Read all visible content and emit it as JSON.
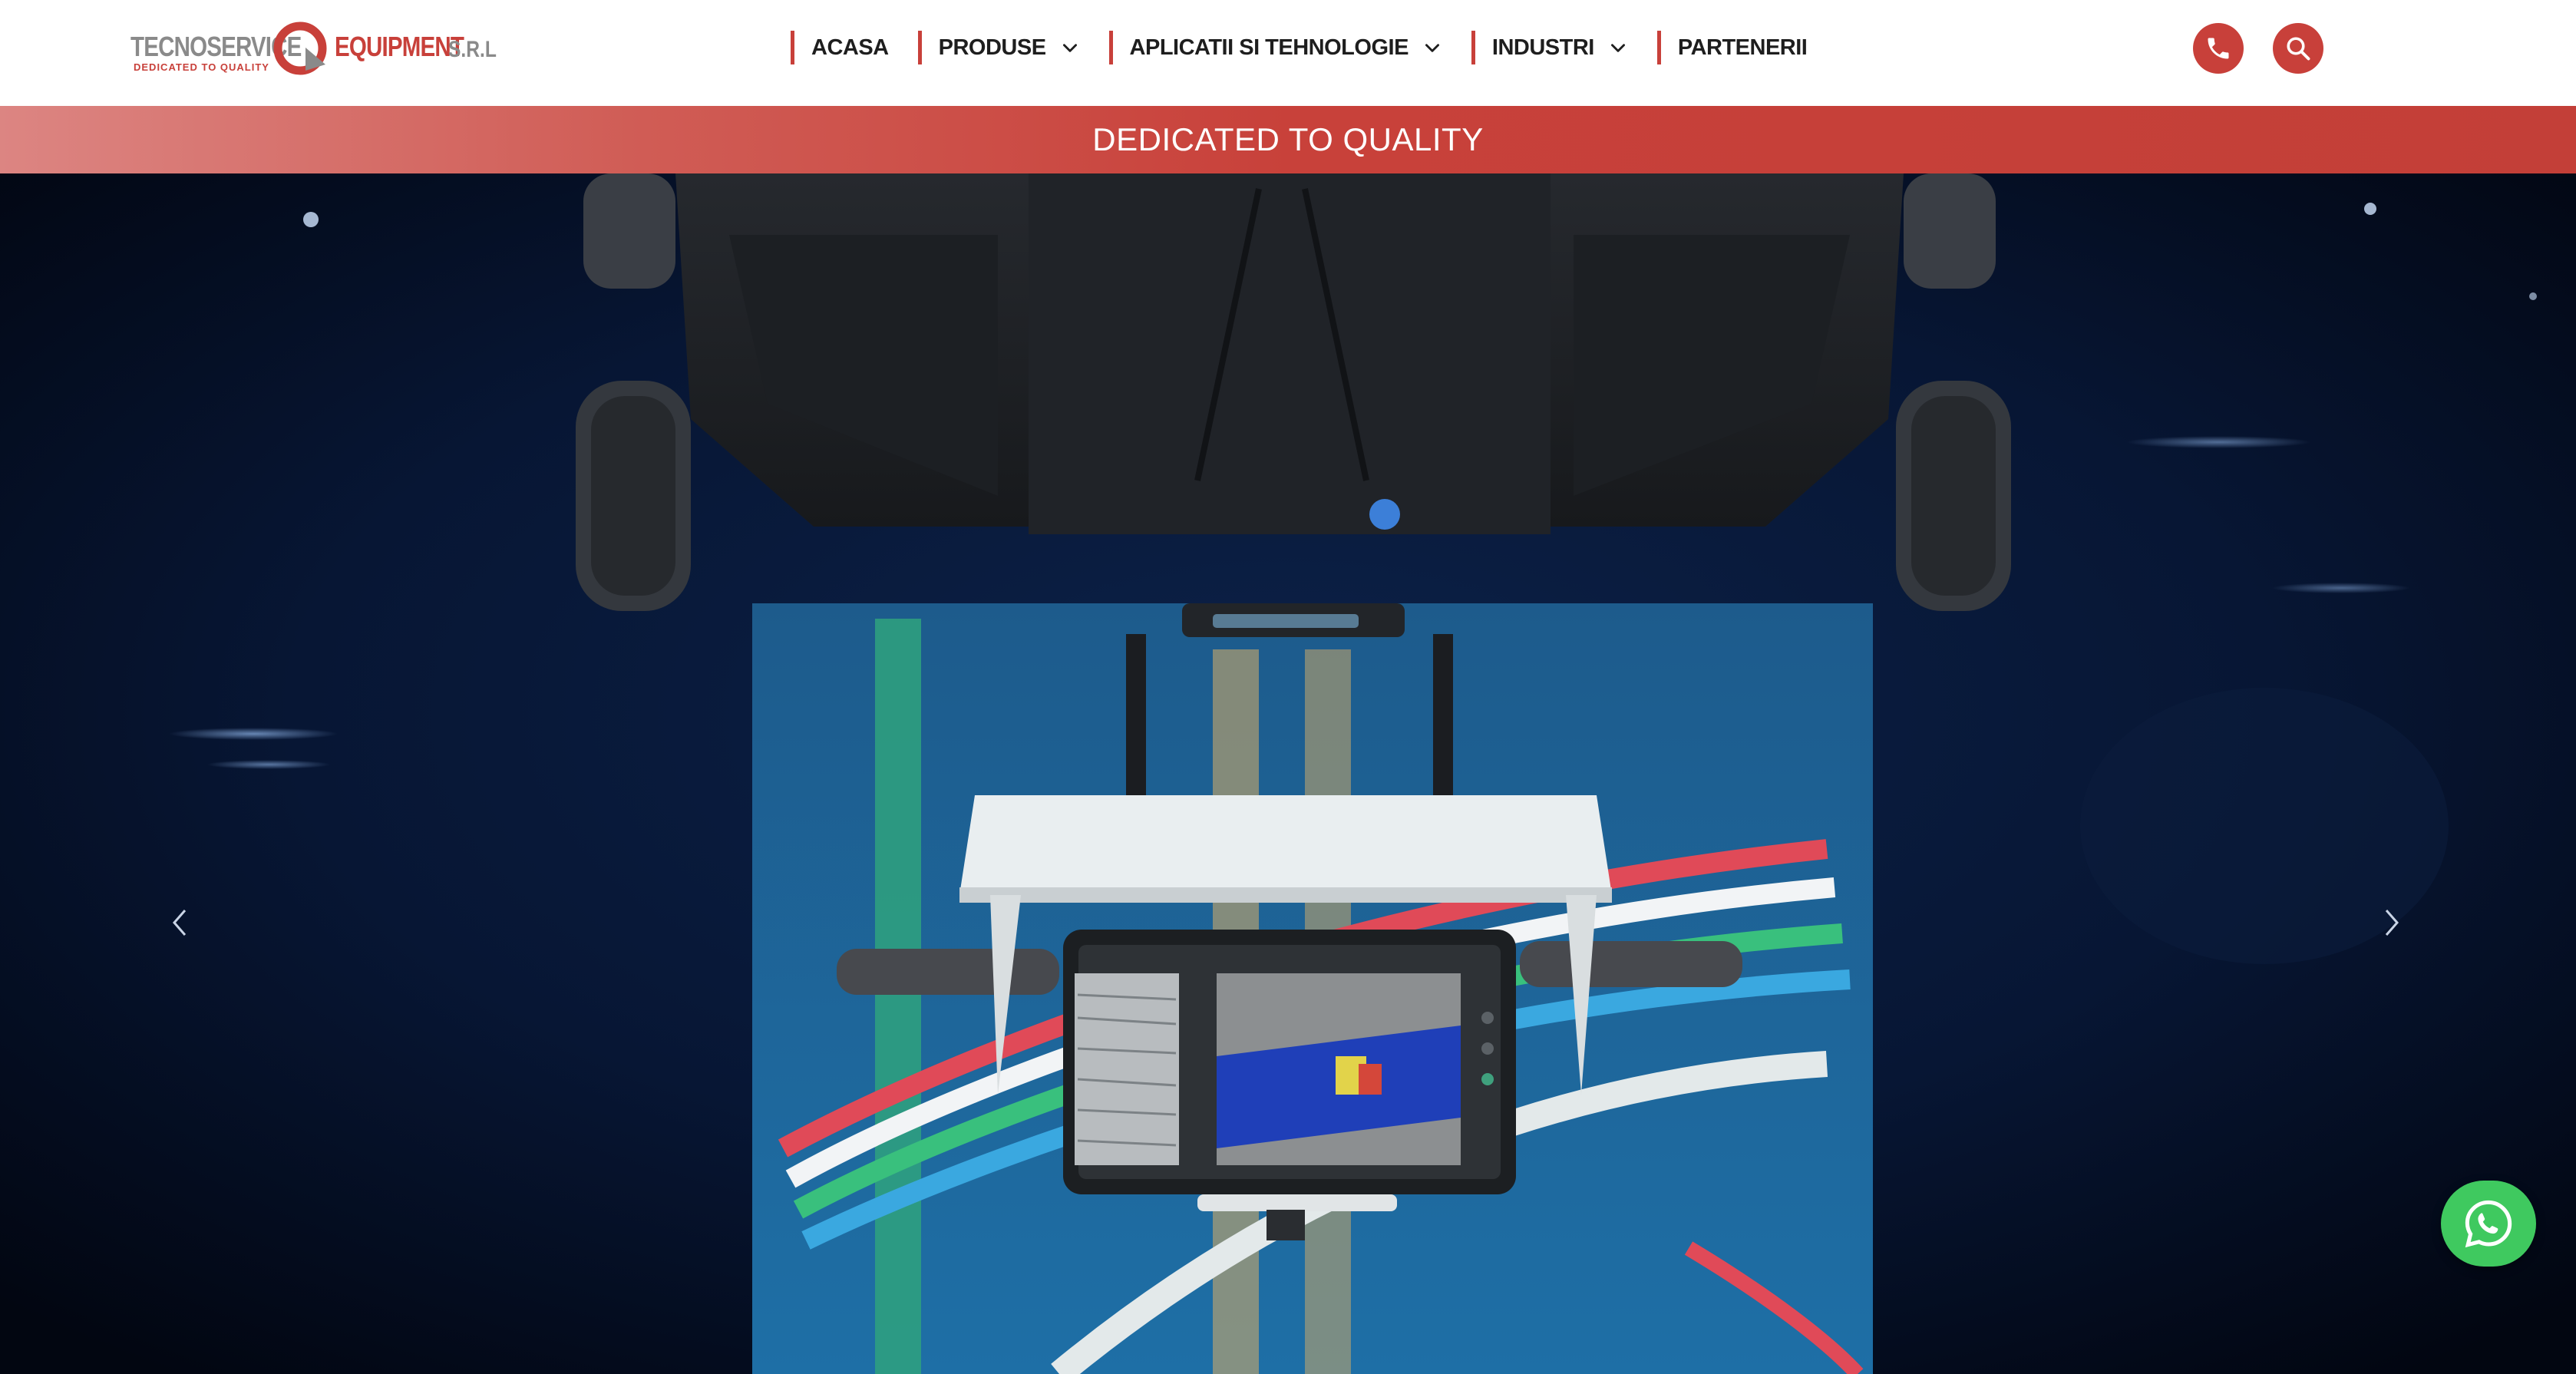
{
  "brand": {
    "name_part1": "TECNOSERVICE",
    "name_part2": "EQUIPMENT",
    "suffix": "S.R.L",
    "tagline_small": "DEDICATED TO QUALITY",
    "color_red": "#c8403a",
    "color_gray": "#8a8a8a"
  },
  "nav": {
    "items": [
      {
        "label": "ACASA",
        "has_dropdown": false
      },
      {
        "label": "PRODUSE",
        "has_dropdown": true
      },
      {
        "label": "APLICATII SI TEHNOLOGIE",
        "has_dropdown": true
      },
      {
        "label": "INDUSTRI",
        "has_dropdown": true
      },
      {
        "label": "PARTENERII",
        "has_dropdown": false
      }
    ]
  },
  "header_actions": {
    "phone_icon": "phone-icon",
    "search_icon": "search-icon"
  },
  "band": {
    "text": "DEDICATED TO QUALITY"
  },
  "hero": {
    "image_subject": "ground-penetrating radar cart with tablet display",
    "prev_icon": "chevron-left-icon",
    "next_icon": "chevron-right-icon"
  },
  "floating": {
    "whatsapp_icon": "whatsapp-icon",
    "whatsapp_color": "#3fc95f"
  }
}
